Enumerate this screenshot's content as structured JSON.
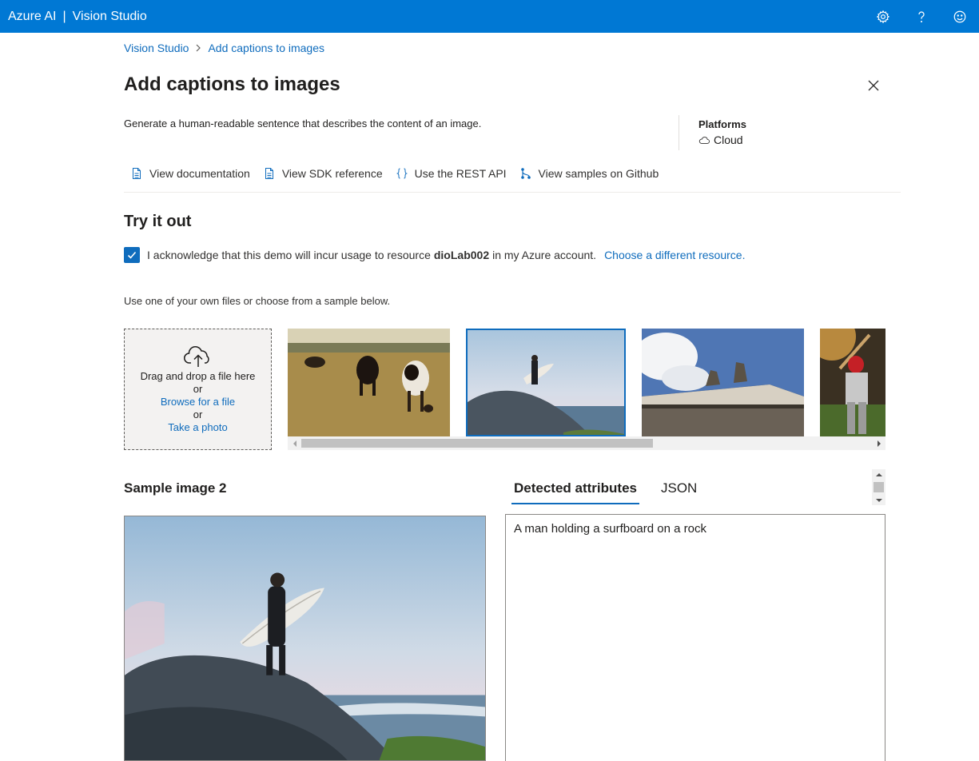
{
  "topbar": {
    "brand": "Azure AI",
    "separator": "|",
    "product": "Vision Studio",
    "icons": [
      "settings-gear-icon",
      "help-question-icon",
      "feedback-smiley-icon"
    ]
  },
  "breadcrumb": {
    "root": "Vision Studio",
    "current": "Add captions to images"
  },
  "page": {
    "title": "Add captions to images",
    "description": "Generate a human-readable sentence that describes the content of an image."
  },
  "platforms": {
    "title": "Platforms",
    "value": "Cloud"
  },
  "links": [
    {
      "label": "View documentation",
      "icon": "document-icon"
    },
    {
      "label": "View SDK reference",
      "icon": "document-icon"
    },
    {
      "label": "Use the REST API",
      "icon": "braces-icon"
    },
    {
      "label": "View samples on Github",
      "icon": "branch-icon"
    }
  ],
  "try_it": {
    "title": "Try it out",
    "ack_prefix": "I acknowledge that this demo will incur usage to resource",
    "resource": "dioLab002",
    "ack_suffix": "in my Azure account.",
    "choose_link": "Choose a different resource.",
    "checked": true,
    "own_files": "Use one of your own files or choose from a sample below."
  },
  "dropzone": {
    "line1": "Drag and drop a file here",
    "or1": "or",
    "browse": "Browse for a file",
    "or2": "or",
    "photo": "Take a photo"
  },
  "samples": {
    "selected_index": 1,
    "items": [
      "cows-in-field",
      "surfer-on-rock",
      "building-statues",
      "baseball-batter"
    ]
  },
  "sample_section": {
    "title": "Sample image 2"
  },
  "result": {
    "tabs": [
      "Detected attributes",
      "JSON"
    ],
    "active_tab": "Detected attributes",
    "caption": "A man holding a surfboard on a rock"
  },
  "colors": {
    "topbar": "#0078d4",
    "link": "#0f6cbd",
    "selected_border": "#0f6cbd"
  }
}
